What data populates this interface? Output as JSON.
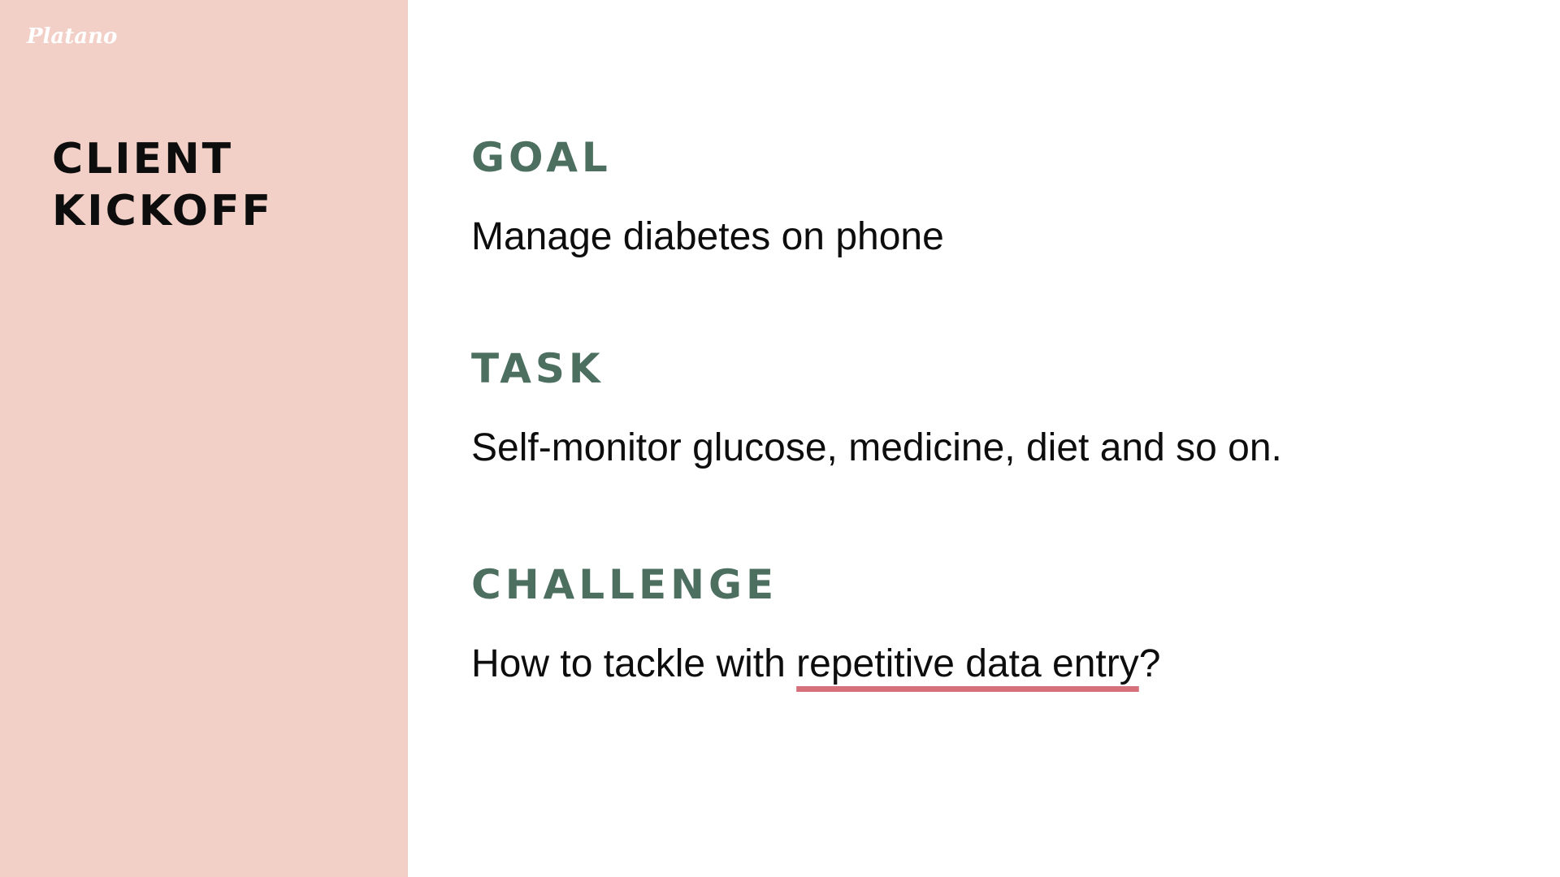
{
  "brand": {
    "logo_text": "Platano"
  },
  "title": {
    "line1": "CLIENT",
    "line2": "KICKOFF"
  },
  "sections": {
    "goal": {
      "heading": "GOAL",
      "body": "Manage diabetes on phone"
    },
    "task": {
      "heading": "TASK",
      "body": "Self-monitor glucose, medicine, diet and so on."
    },
    "challenge": {
      "heading": "CHALLENGE",
      "body_prefix": "How to tackle with ",
      "body_highlight": "repetitive data entry",
      "body_suffix": "?"
    }
  },
  "colors": {
    "side_panel": "#f2d0c7",
    "heading": "#4d6f60",
    "body_text": "#0d0d0d",
    "highlight_underline": "#d6707a",
    "background": "#ffffff"
  }
}
